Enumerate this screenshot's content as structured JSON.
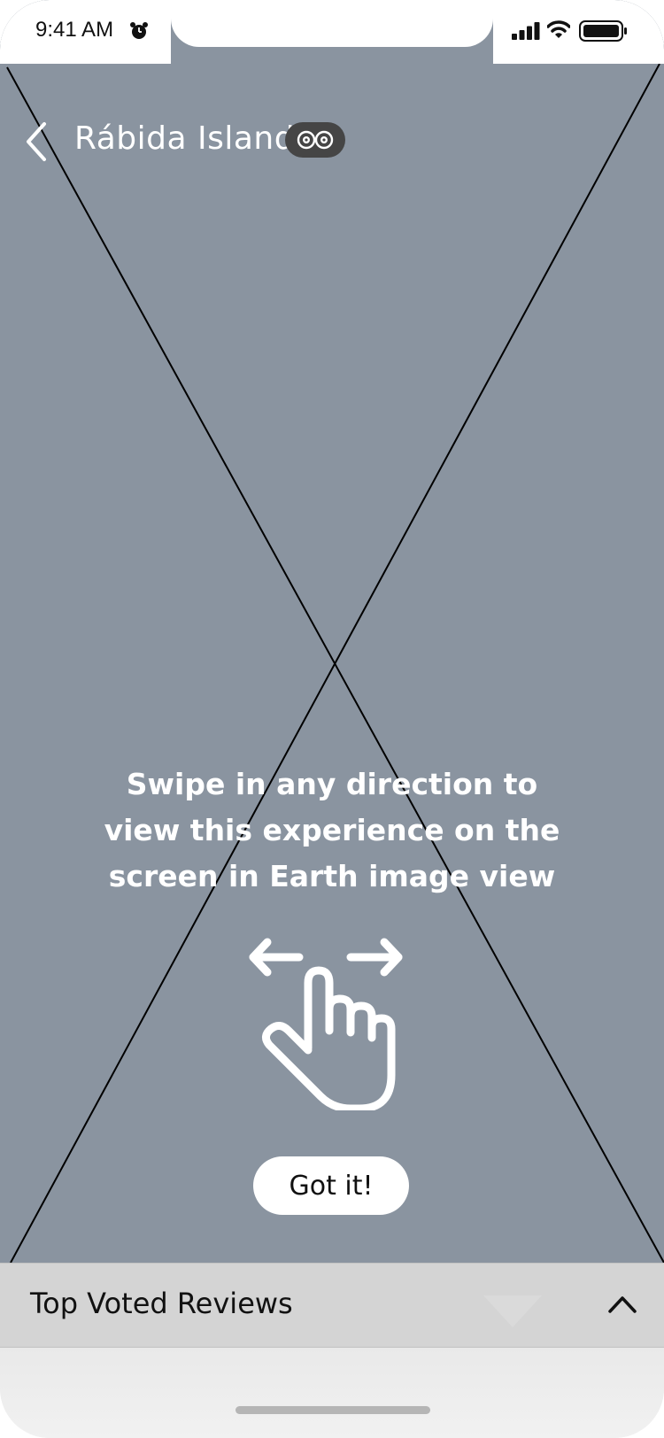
{
  "status_bar": {
    "time": "9:41 AM",
    "icons": [
      "alarm-icon",
      "cellular-signal-icon",
      "wifi-icon",
      "battery-icon"
    ]
  },
  "header": {
    "title": "Rábida Island",
    "back_icon": "chevron-left-icon",
    "badge_icon": "tripadvisor-owl-icon"
  },
  "overlay": {
    "instruction_line1": "Swipe in any direction to",
    "instruction_line2": "view this experience on the",
    "instruction_line3": "screen in Earth image view",
    "gesture_icon": "swipe-hand-icon",
    "button_label": "Got it!"
  },
  "reviews_bar": {
    "title": "Top Voted Reviews",
    "toggle_icon": "chevron-up-icon"
  },
  "colors": {
    "photo_placeholder": "#8a94a0",
    "reviews_bar": "#d4d4d4",
    "badge": "#454545"
  }
}
